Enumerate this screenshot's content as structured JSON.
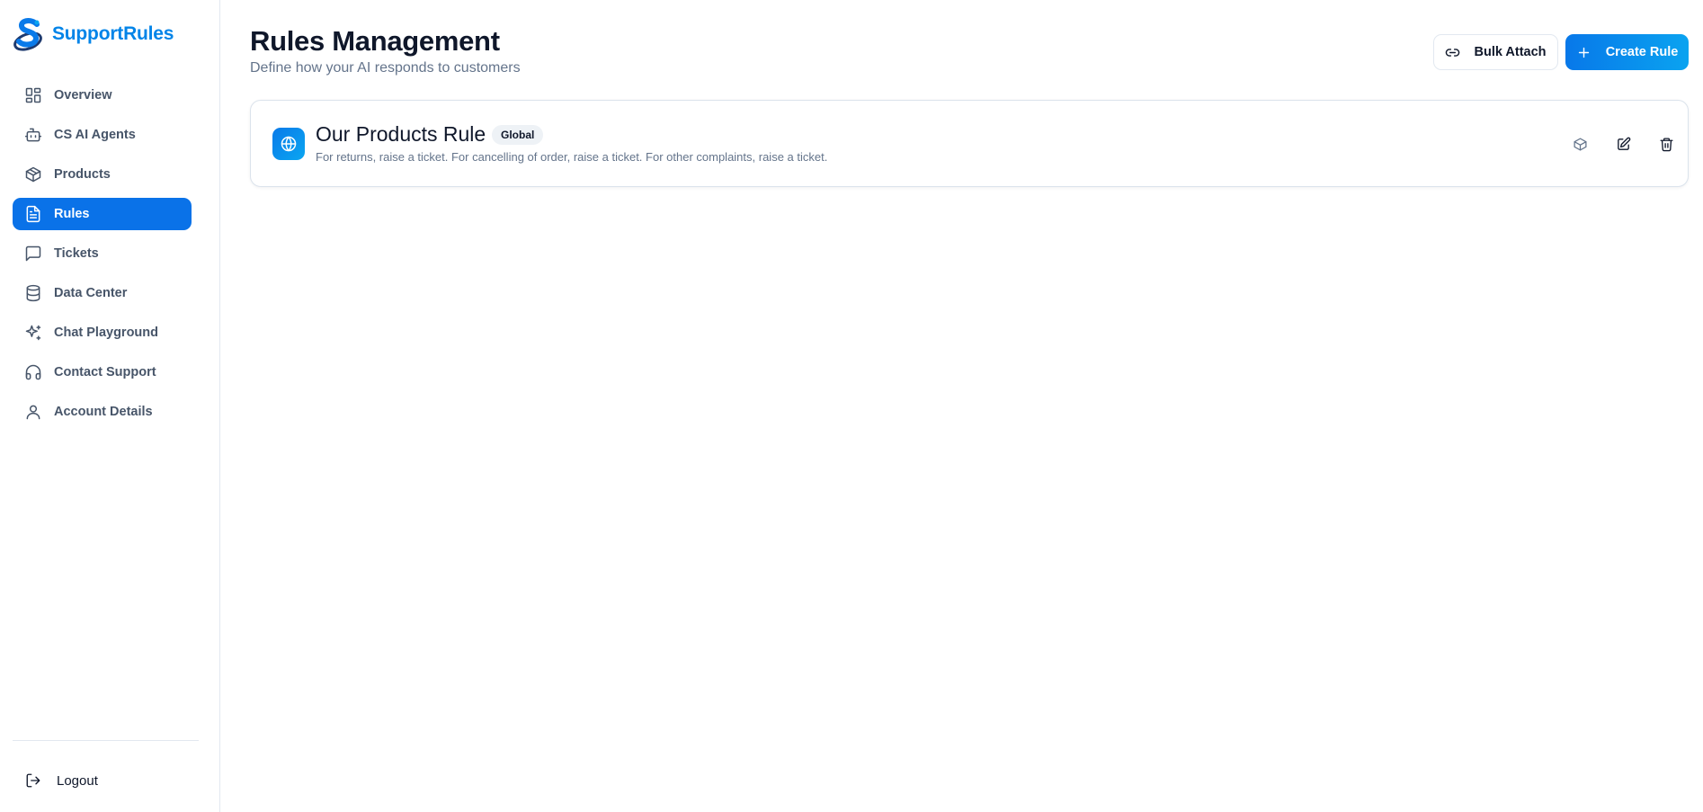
{
  "brand": {
    "name": "SupportRules",
    "accent": "#0284e8"
  },
  "sidebar": {
    "items": [
      {
        "label": "Overview",
        "icon": "layout-grid-icon",
        "active": false
      },
      {
        "label": "CS AI Agents",
        "icon": "bot-icon",
        "active": false
      },
      {
        "label": "Products",
        "icon": "box-icon",
        "active": false
      },
      {
        "label": "Rules",
        "icon": "file-text-icon",
        "active": true
      },
      {
        "label": "Tickets",
        "icon": "message-square-icon",
        "active": false
      },
      {
        "label": "Data Center",
        "icon": "database-icon",
        "active": false
      },
      {
        "label": "Chat Playground",
        "icon": "sparkles-icon",
        "active": false
      },
      {
        "label": "Contact Support",
        "icon": "headphones-icon",
        "active": false
      },
      {
        "label": "Account Details",
        "icon": "user-icon",
        "active": false
      }
    ],
    "logout_label": "Logout"
  },
  "header": {
    "title": "Rules Management",
    "subtitle": "Define how your AI responds to customers",
    "bulk_attach_label": "Bulk Attach",
    "create_rule_label": "Create Rule"
  },
  "rules": [
    {
      "title": "Our Products Rule",
      "badge": "Global",
      "description": "For returns, raise a ticket. For cancelling of order, raise a ticket. For other complaints, raise a ticket.",
      "icon": "globe-icon",
      "actions": [
        "products-icon",
        "edit-icon",
        "trash-icon"
      ]
    }
  ],
  "colors": {
    "primary": "#0a72e8",
    "muted_text": "#64748b",
    "border": "#e2e8f0"
  }
}
